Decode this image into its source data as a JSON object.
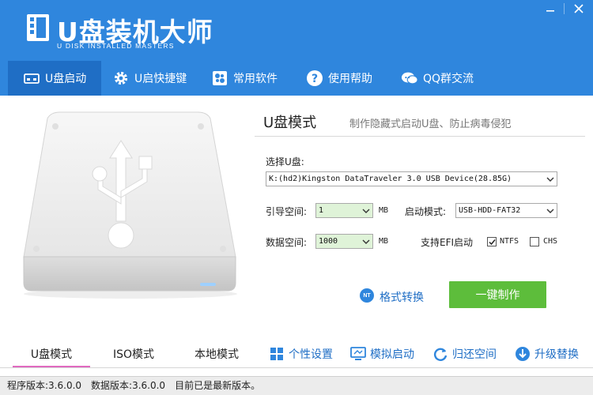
{
  "app": {
    "title": "U盘装机大师",
    "subtitle": "U DISK INSTALLED MASTERS",
    "minimize_icon": "minimize-icon",
    "close_icon": "close-icon",
    "brand_color": "#2f86dd"
  },
  "nav": {
    "items": [
      {
        "label": "U盘启动",
        "icon": "usb-drive-icon",
        "active": true
      },
      {
        "label": "U启快捷键",
        "icon": "gear-icon",
        "active": false
      },
      {
        "label": "常用软件",
        "icon": "software-icon",
        "active": false
      },
      {
        "label": "使用帮助",
        "icon": "help-icon",
        "active": false
      },
      {
        "label": "QQ群交流",
        "icon": "chat-icon",
        "active": false
      }
    ]
  },
  "main": {
    "mode_title": "U盘模式",
    "mode_desc": "制作隐藏式启动U盘、防止病毒侵犯",
    "select_disk_label": "选择U盘:",
    "select_disk_value": "K:(hd2)Kingston DataTraveler 3.0 USB Device(28.85G)",
    "boot_space_label": "引导空间:",
    "boot_space_value": "1",
    "boot_space_unit": "MB",
    "boot_mode_label": "启动模式:",
    "boot_mode_value": "USB-HDD-FAT32",
    "data_space_label": "数据空间:",
    "data_space_value": "1000",
    "data_space_unit": "MB",
    "efi_label": "支持EFI启动",
    "ntfs_label": "NTFS",
    "ntfs_checked": true,
    "chs_label": "CHS",
    "chs_checked": false,
    "format_convert_badge": "NT",
    "format_convert_label": "格式转换",
    "make_button_label": "一键制作",
    "make_button_color": "#5dbd3b"
  },
  "bottom": {
    "tabs": [
      {
        "label": "U盘模式",
        "active": true
      },
      {
        "label": "ISO模式",
        "active": false
      },
      {
        "label": "本地模式",
        "active": false
      }
    ],
    "tools": [
      {
        "label": "个性设置",
        "icon": "grid-icon"
      },
      {
        "label": "模拟启动",
        "icon": "monitor-icon"
      },
      {
        "label": "归还空间",
        "icon": "refresh-icon"
      },
      {
        "label": "升级替换",
        "icon": "download-icon"
      }
    ]
  },
  "status": {
    "program_version": "程序版本:3.6.0.0",
    "data_version": "数据版本:3.6.0.0",
    "update_msg": "目前已是最新版本。"
  }
}
